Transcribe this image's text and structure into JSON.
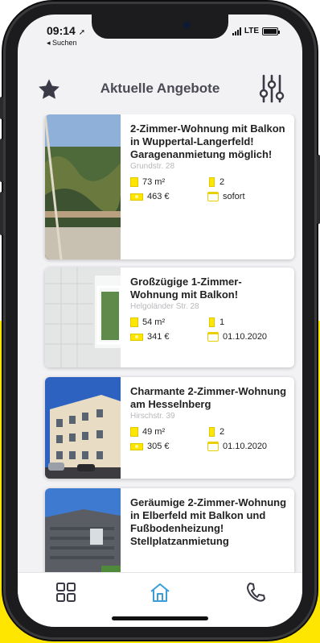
{
  "status_bar": {
    "time": "09:14",
    "back_app": "◂ Suchen",
    "network": "LTE"
  },
  "header": {
    "title": "Aktuelle Angebote",
    "favorites_icon": "star-icon",
    "filter_icon": "sliders-icon"
  },
  "listings": [
    {
      "title": "2-Zimmer-Wohnung mit Balkon in Wuppertal-Langerfeld! Garagenanmietung möglich!",
      "address": "Grundstr. 28",
      "area": "73 m²",
      "rooms": "2",
      "rent": "463 €",
      "available": "sofort"
    },
    {
      "title": "Großzügige 1-Zimmer-Wohnung mit Balkon!",
      "address": "Helgoländer Str. 28",
      "area": "54 m²",
      "rooms": "1",
      "rent": "341 €",
      "available": "01.10.2020"
    },
    {
      "title": "Charmante 2-Zimmer-Wohnung am Hesselnberg",
      "address": "Hirschstr. 39",
      "area": "49 m²",
      "rooms": "2",
      "rent": "305 €",
      "available": "01.10.2020"
    },
    {
      "title": "Geräumige 2-Zimmer-Wohnung in Elberfeld mit Balkon und Fußbodenheizung! Stellplatzanmietung",
      "address": "",
      "area": "",
      "rooms": "",
      "rent": "",
      "available": ""
    }
  ],
  "tabbar": {
    "items": [
      {
        "icon": "grid-icon",
        "active": false
      },
      {
        "icon": "home-icon",
        "active": true
      },
      {
        "icon": "phone-icon",
        "active": false
      }
    ]
  },
  "colors": {
    "accent": "#ffe600",
    "active_tab": "#3a9fd8",
    "title_text": "#4a4a55"
  }
}
